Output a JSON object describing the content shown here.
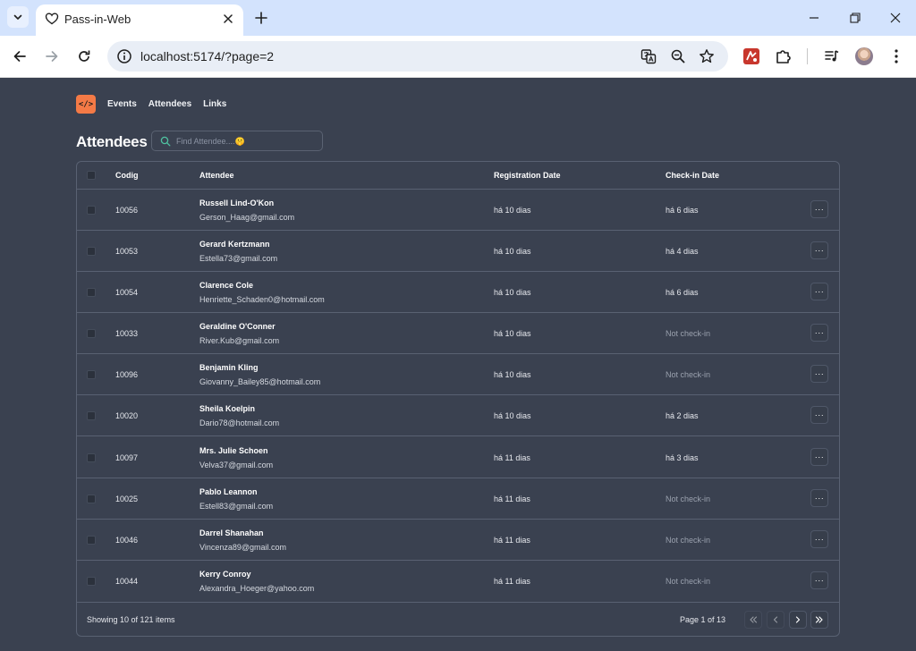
{
  "browser": {
    "tab_title": "Pass-in-Web",
    "url": "localhost:5174/?page=2"
  },
  "app": {
    "logo_text": "</>",
    "nav": [
      "Events",
      "Attendees",
      "Links"
    ],
    "heading": "Attendees",
    "search_placeholder": "Find Attendee....🤫"
  },
  "table": {
    "headers": {
      "code": "Codig",
      "attendee": "Attendee",
      "registration": "Registration Date",
      "checkin": "Check-in Date"
    },
    "rows": [
      {
        "code": "10056",
        "name": "Russell Lind-O'Kon",
        "email": "Gerson_Haag@gmail.com",
        "registered": "há 10 dias",
        "checkin": "há 6 dias",
        "checked_in": true
      },
      {
        "code": "10053",
        "name": "Gerard Kertzmann",
        "email": "Estella73@gmail.com",
        "registered": "há 10 dias",
        "checkin": "há 4 dias",
        "checked_in": true
      },
      {
        "code": "10054",
        "name": "Clarence Cole",
        "email": "Henriette_Schaden0@hotmail.com",
        "registered": "há 10 dias",
        "checkin": "há 6 dias",
        "checked_in": true
      },
      {
        "code": "10033",
        "name": "Geraldine O'Conner",
        "email": "River.Kub@gmail.com",
        "registered": "há 10 dias",
        "checkin": "Not check-in",
        "checked_in": false
      },
      {
        "code": "10096",
        "name": "Benjamin Kling",
        "email": "Giovanny_Bailey85@hotmail.com",
        "registered": "há 10 dias",
        "checkin": "Not check-in",
        "checked_in": false
      },
      {
        "code": "10020",
        "name": "Sheila Koelpin",
        "email": "Dario78@hotmail.com",
        "registered": "há 10 dias",
        "checkin": "há 2 dias",
        "checked_in": true
      },
      {
        "code": "10097",
        "name": "Mrs. Julie Schoen",
        "email": "Velva37@gmail.com",
        "registered": "há 11 dias",
        "checkin": "há 3 dias",
        "checked_in": true
      },
      {
        "code": "10025",
        "name": "Pablo Leannon",
        "email": "Estell83@gmail.com",
        "registered": "há 11 dias",
        "checkin": "Not check-in",
        "checked_in": false
      },
      {
        "code": "10046",
        "name": "Darrel Shanahan",
        "email": "Vincenza89@gmail.com",
        "registered": "há 11 dias",
        "checkin": "Not check-in",
        "checked_in": false
      },
      {
        "code": "10044",
        "name": "Kerry Conroy",
        "email": "Alexandra_Hoeger@yahoo.com",
        "registered": "há 11 dias",
        "checkin": "Not check-in",
        "checked_in": false
      }
    ],
    "footer": {
      "showing": "Showing 10 of 121 items",
      "page_label": "Page 1 of 13"
    },
    "more_label": "···"
  },
  "icons": {
    "tab_search": "chevron-down-icon",
    "favicon": "heart-icon",
    "more": "ellipsis-icon",
    "pagination": [
      "chevrons-left-icon",
      "chevron-left-icon",
      "chevron-right-icon",
      "chevrons-right-icon"
    ]
  },
  "colors": {
    "app_background": "#3a4150",
    "accent": "#f47a46",
    "border": "#596172"
  }
}
